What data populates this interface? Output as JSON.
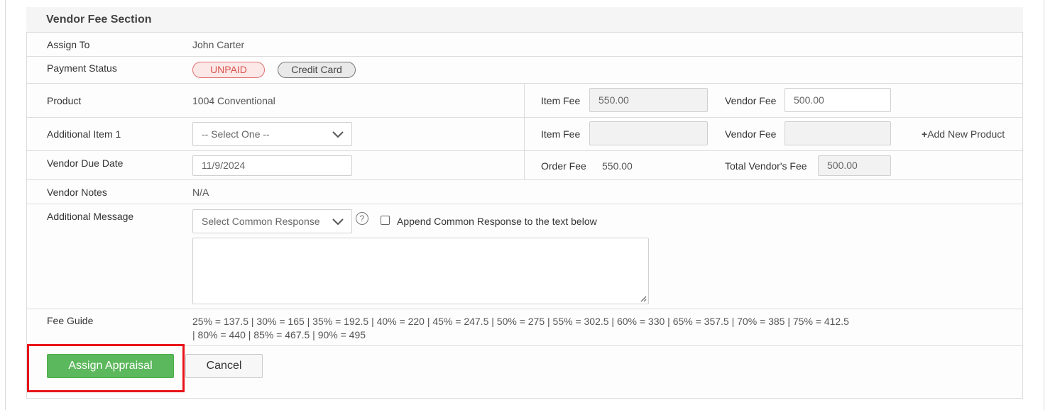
{
  "section": {
    "title": "Vendor Fee Section"
  },
  "assign_to": {
    "label": "Assign To",
    "value": "John Carter"
  },
  "payment_status": {
    "label": "Payment Status",
    "status_badge": "UNPAID",
    "method_badge": "Credit Card"
  },
  "product": {
    "label": "Product",
    "value": "1004 Conventional",
    "item_fee_label": "Item Fee",
    "item_fee_value": "550.00",
    "vendor_fee_label": "Vendor Fee",
    "vendor_fee_value": "500.00"
  },
  "additional_item": {
    "label": "Additional Item 1",
    "select_value": "-- Select One --",
    "item_fee_label": "Item Fee",
    "item_fee_value": "",
    "vendor_fee_label": "Vendor Fee",
    "vendor_fee_value": "",
    "add_product_label": "Add New Product"
  },
  "due_date": {
    "label": "Vendor Due Date",
    "value": "11/9/2024",
    "order_fee_label": "Order Fee",
    "order_fee_value": "550.00",
    "total_vendor_fee_label": "Total Vendor's Fee",
    "total_vendor_fee_value": "500.00"
  },
  "vendor_notes": {
    "label": "Vendor Notes",
    "value": "N/A"
  },
  "additional_message": {
    "label": "Additional Message",
    "select_value": "Select Common Response",
    "help_icon": "?",
    "append_label": "Append Common Response to the text below",
    "message_text": ""
  },
  "fee_guide": {
    "label": "Fee Guide",
    "line1": "25% = 137.5 | 30% = 165 | 35% = 192.5 | 40% = 220 | 45% = 247.5 | 50% = 275 | 55% = 302.5 | 60% = 330 | 65% = 357.5 | 70% = 385 | 75% = 412.5",
    "line2": "| 80% = 440 | 85% = 467.5 | 90% = 495"
  },
  "actions": {
    "assign_label": "Assign Appraisal",
    "cancel_label": "Cancel"
  },
  "colors": {
    "primary_button": "#5cb85c",
    "unpaid": "#d9534f",
    "highlight": "#e8131a"
  }
}
